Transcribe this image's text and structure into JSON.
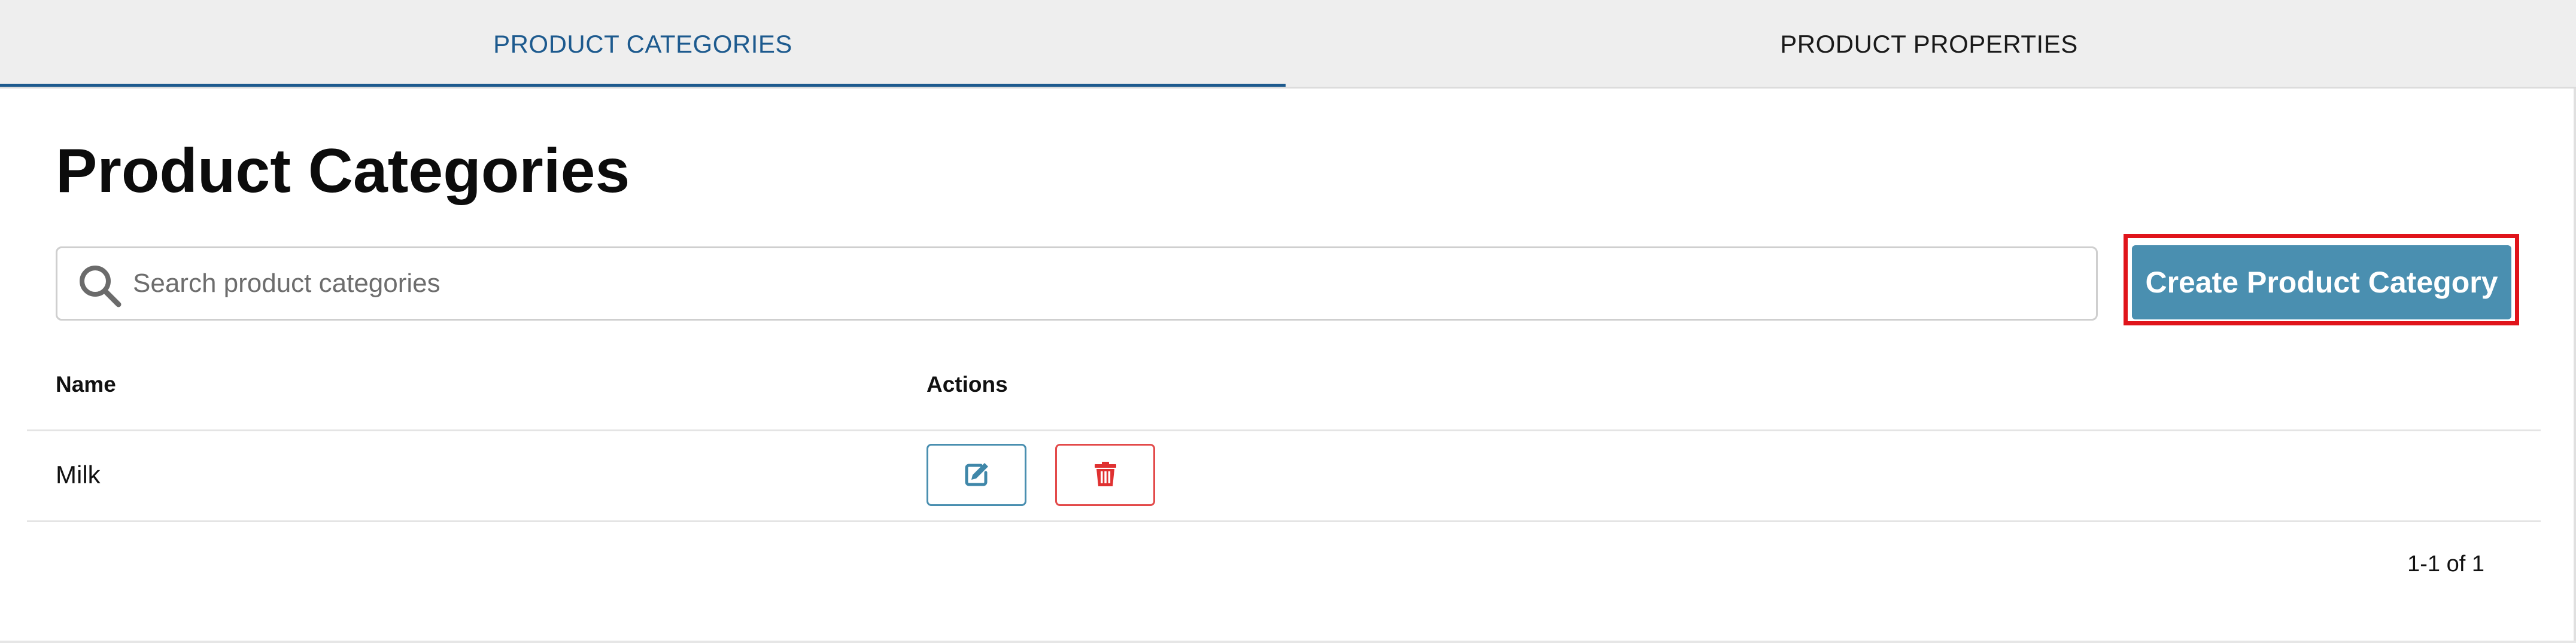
{
  "tabs": {
    "categories_label": "PRODUCT CATEGORIES",
    "properties_label": "PRODUCT PROPERTIES",
    "active": "categories"
  },
  "page": {
    "title": "Product Categories"
  },
  "search": {
    "placeholder": "Search product categories",
    "value": "",
    "icon": "search-icon"
  },
  "actions": {
    "create_label": "Create Product Category"
  },
  "table": {
    "columns": [
      "Name",
      "Actions"
    ],
    "rows": [
      {
        "name": "Milk",
        "actions": [
          "edit-icon",
          "trash-icon"
        ]
      }
    ]
  },
  "pagination": {
    "text": "1-1 of 1"
  },
  "colors": {
    "accent": "#1d5a8e",
    "button": "#4a8fb0",
    "danger": "#e34a4a",
    "highlight": "#e0141b"
  }
}
